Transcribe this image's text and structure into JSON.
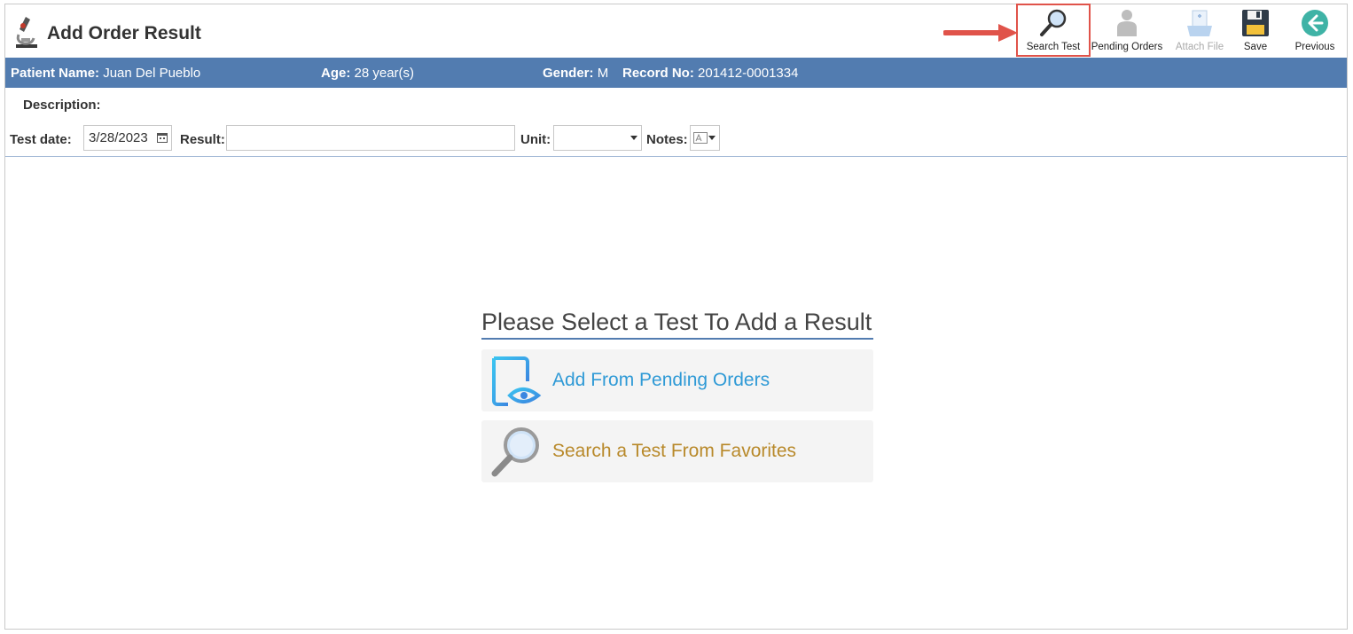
{
  "header": {
    "title": "Add Order Result"
  },
  "toolbar": {
    "search_test": "Search Test",
    "pending_orders": "Pending Orders",
    "attach_file": "Attach File",
    "save": "Save",
    "previous": "Previous"
  },
  "patient": {
    "name_label": "Patient Name:",
    "name_value": "Juan Del Pueblo",
    "age_label": "Age:",
    "age_value": "28 year(s)",
    "gender_label": "Gender:",
    "gender_value": "M",
    "record_label": "Record No:",
    "record_value": "201412-0001334"
  },
  "form": {
    "description_label": "Description:",
    "test_date_label": "Test date:",
    "test_date_value": "3/28/2023",
    "result_label": "Result:",
    "result_value": "",
    "unit_label": "Unit:",
    "unit_value": "",
    "notes_label": "Notes:"
  },
  "main": {
    "prompt": "Please Select a Test To Add a Result",
    "option_pending": "Add From Pending Orders",
    "option_favorites": "Search a Test From Favorites"
  },
  "colors": {
    "patient_bar": "#527cb0",
    "option_pending_text": "#2f9ad6",
    "option_favorites_text": "#b8892a",
    "highlight": "#e0534a"
  }
}
